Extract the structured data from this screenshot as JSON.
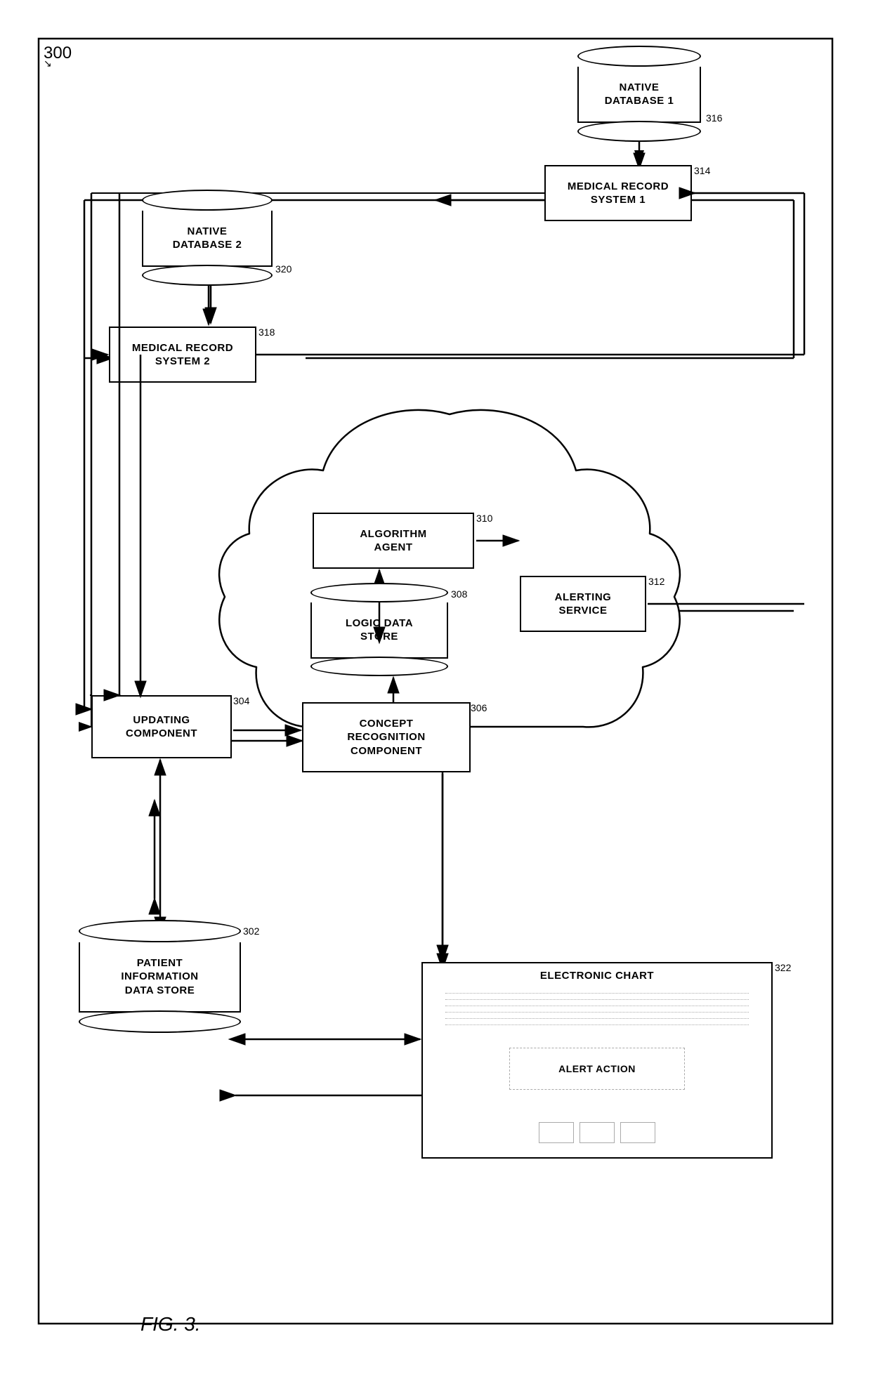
{
  "diagram": {
    "ref": "300",
    "fig_label": "FIG. 3.",
    "components": {
      "native_db1": {
        "label": "NATIVE\nDATABASE 1",
        "ref": "316"
      },
      "medical_record1": {
        "label": "MEDICAL RECORD\nSYSTEM 1",
        "ref": "314"
      },
      "native_db2": {
        "label": "NATIVE\nDATABASE 2",
        "ref": "320"
      },
      "medical_record2": {
        "label": "MEDICAL RECORD\nSYSTEM 2",
        "ref": "318"
      },
      "algorithm_agent": {
        "label": "ALGORITHM\nAGENT",
        "ref": "310"
      },
      "logic_data_store": {
        "label": "LOGIC DATA\nSTORE",
        "ref": "308"
      },
      "alerting_service": {
        "label": "ALERTING\nSERVICE",
        "ref": "312"
      },
      "concept_recognition": {
        "label": "CONCEPT\nRECOGNITION\nCOMPONENT",
        "ref": "306"
      },
      "updating_component": {
        "label": "UPDATING\nCOMPONENT",
        "ref": "304"
      },
      "patient_info": {
        "label": "PATIENT\nINFORMATION\nDATA STORE",
        "ref": "302"
      },
      "electronic_chart": {
        "label": "ELECTRONIC CHART",
        "ref": "322"
      },
      "alert_action": {
        "label": "ALERT ACTION",
        "ref": ""
      }
    }
  }
}
